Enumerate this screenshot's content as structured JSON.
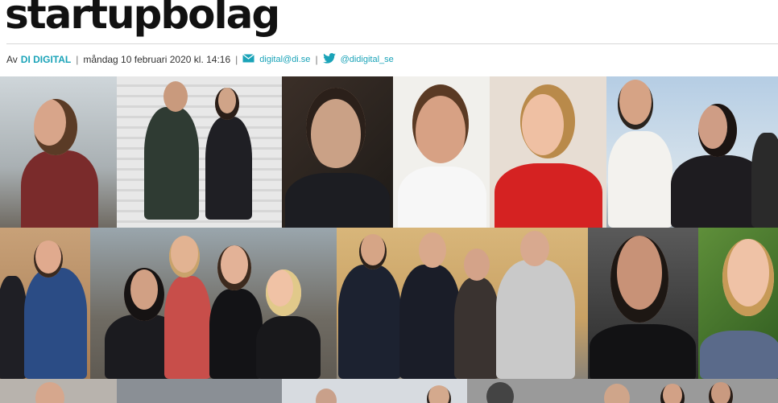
{
  "article": {
    "headline": "startupbolag",
    "byline_prefix": "Av",
    "author": "DI DIGITAL",
    "date": "måndag 10 februari 2020 kl. 14:16",
    "email": "digital@di.se",
    "twitter": "@didigital_se"
  },
  "icons": {
    "email": "envelope-icon",
    "twitter": "twitter-bird-icon"
  },
  "colors": {
    "accent": "#1aa3b8",
    "headline": "#111111"
  }
}
